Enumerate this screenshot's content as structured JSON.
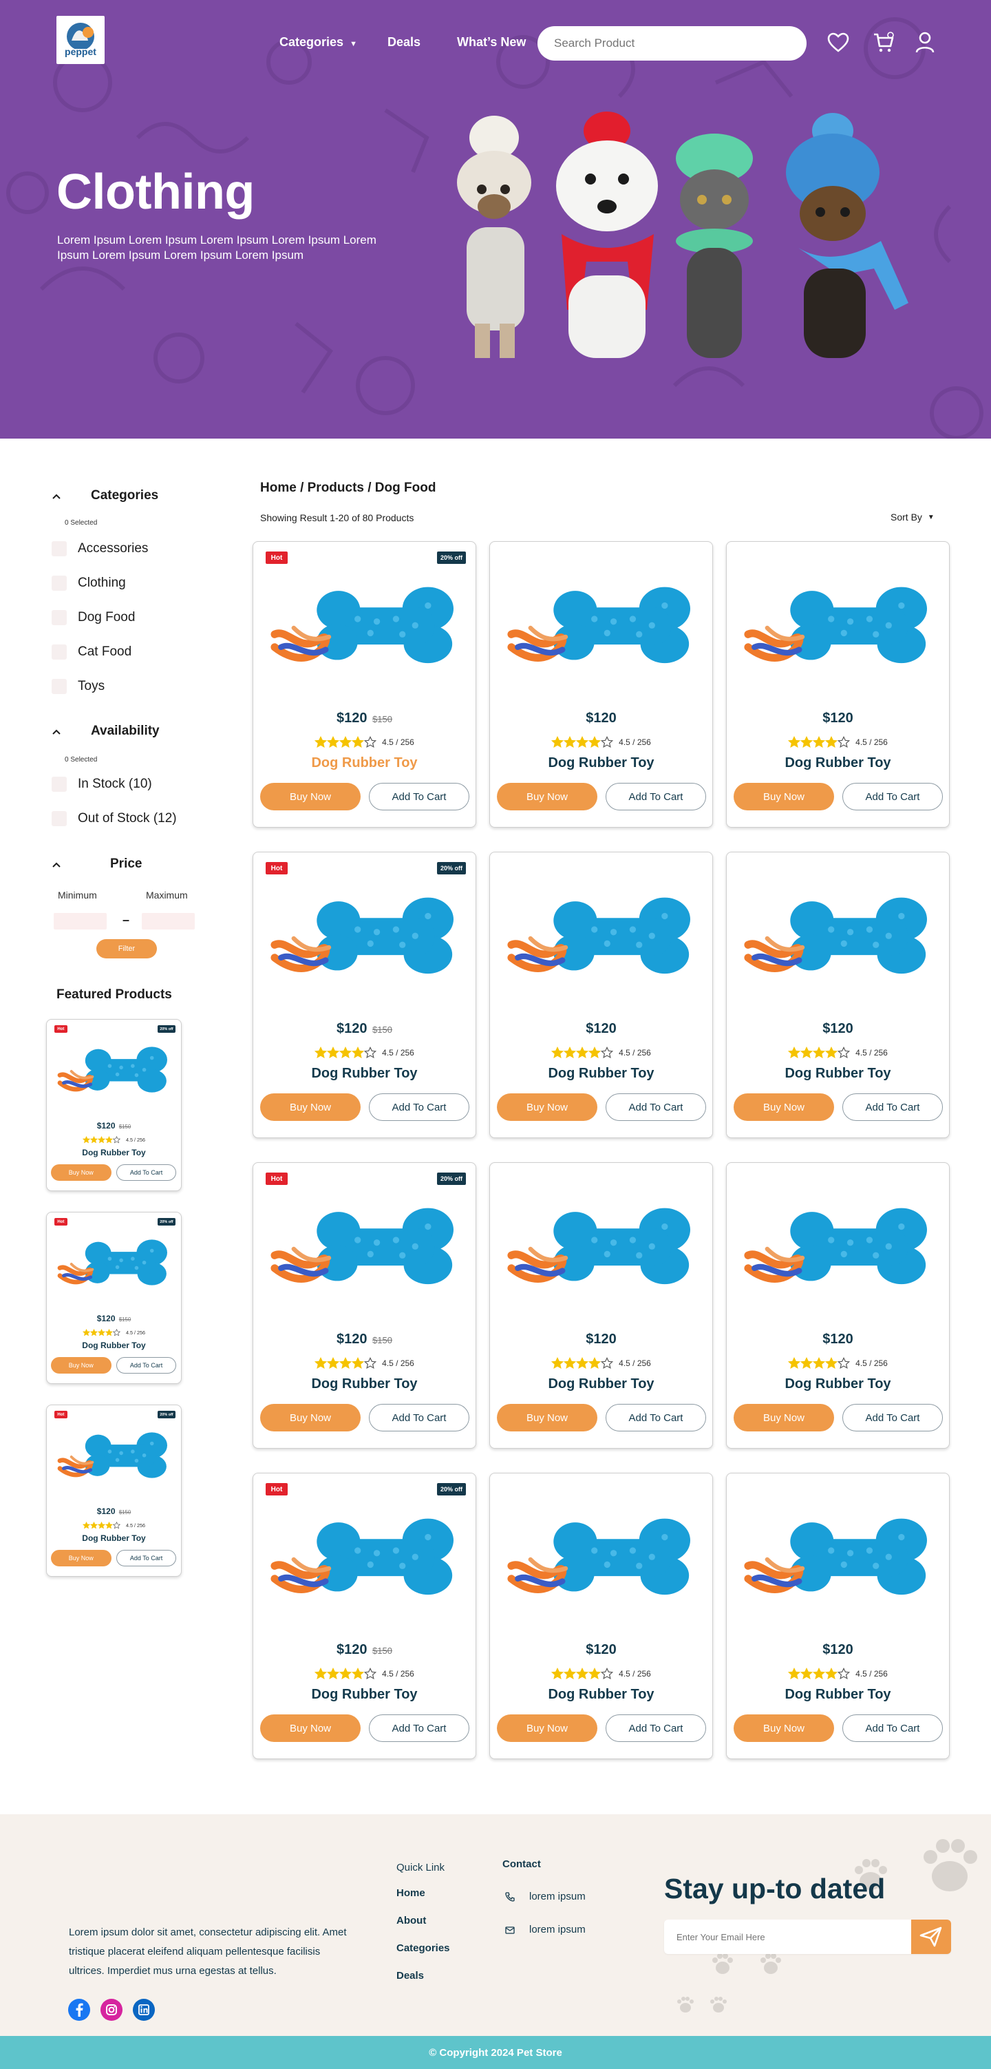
{
  "brand": {
    "name": "peppet"
  },
  "nav": {
    "categories": "Categories",
    "deals": "Deals",
    "whats_new": "What’s New",
    "search_placeholder": "Search Product"
  },
  "hero": {
    "title": "Clothing",
    "subtitle": "Lorem Ipsum Lorem Ipsum Lorem Ipsum Lorem Ipsum Lorem Ipsum Lorem Ipsum Lorem Ipsum Lorem Ipsum"
  },
  "sidebar": {
    "categories": {
      "title": "Categories",
      "selected": "0 Selected",
      "items": [
        "Accessories",
        "Clothing",
        "Dog Food",
        "Cat Food",
        "Toys"
      ]
    },
    "availability": {
      "title": "Availability",
      "selected": "0 Selected",
      "items": [
        "In Stock  (10)",
        "Out of Stock  (12)"
      ]
    },
    "price": {
      "title": "Price",
      "min_label": "Minimum",
      "max_label": "Maximum",
      "dash": "–",
      "filter": "Filter"
    },
    "featured_title": "Featured Products"
  },
  "listing": {
    "breadcrumb": "Home / Products / Dog Food",
    "showing": "Showing Result 1-20 of 80 Products",
    "sort_by": "Sort By"
  },
  "product": {
    "name": "Dog Rubber Toy",
    "price": "$120",
    "old_price": "$150",
    "rating_text": "4.5 / 256",
    "rating_value": 4,
    "hot_label": "Hot",
    "discount_label": "20% off",
    "buy_label": "Buy Now",
    "cart_label": "Add To Cart"
  },
  "footer": {
    "description": "Lorem ipsum dolor sit amet, consectetur adipiscing elit. Amet tristique placerat eleifend aliquam pellentesque facilisis ultrices. Imperdiet mus urna egestas at tellus.",
    "quick_link_title": "Quick Link",
    "quick_links": [
      "Home",
      "About",
      "Categories",
      "Deals"
    ],
    "contact_title": "Contact",
    "contacts": [
      "lorem ipsum",
      "lorem ipsum"
    ],
    "newsletter_title": "Stay up-to dated",
    "email_placeholder": "Enter Your Email Here",
    "copyright": "© Copyright 2024 Pet Store"
  },
  "colors": {
    "hero_purple": "#7c4aa3",
    "accent_orange": "#ef9a49",
    "navy": "#143a4c",
    "hot_red": "#e2222c",
    "footer_bg": "#f6f1ec",
    "copyright_teal": "#5ec4cb"
  }
}
